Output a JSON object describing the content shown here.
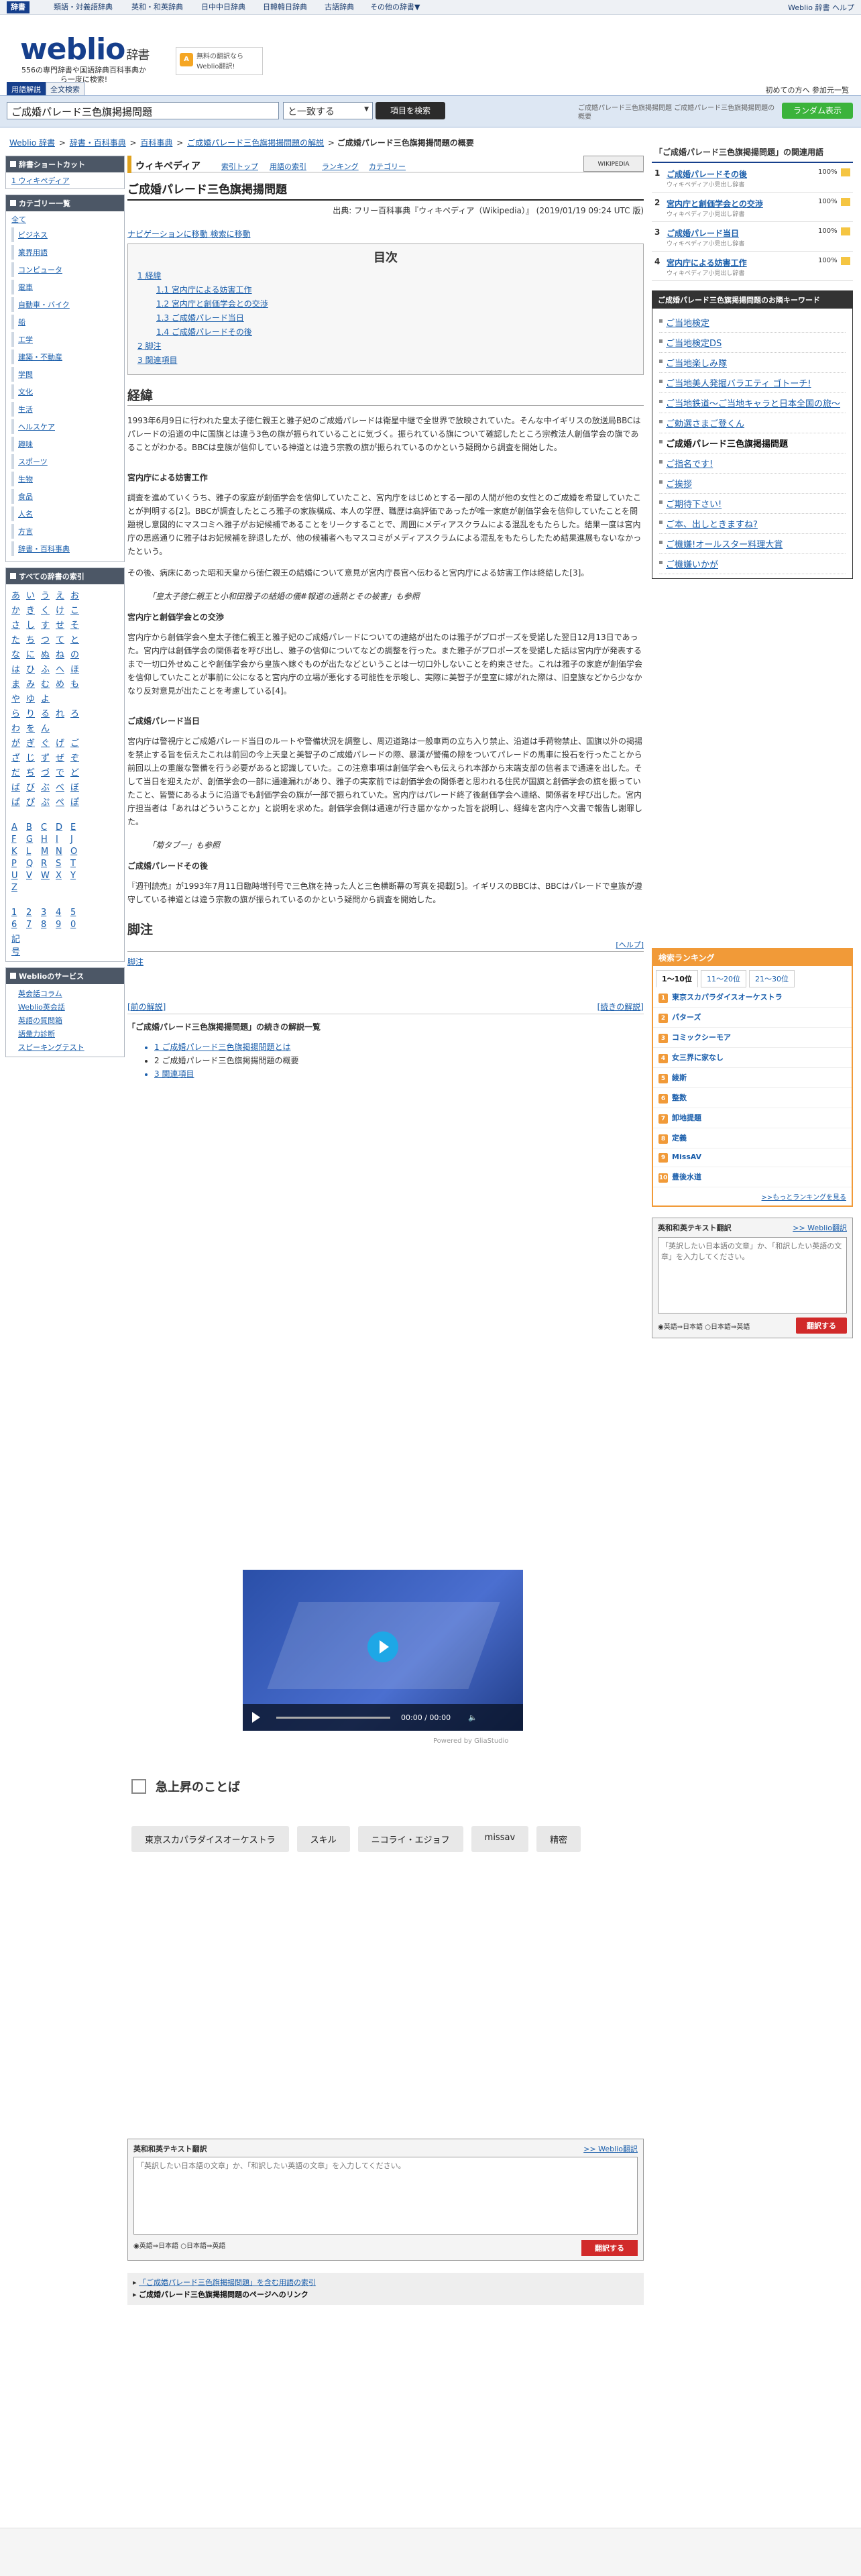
{
  "topbar": {
    "tabs": [
      "辞書",
      "類語・対義語辞典",
      "英和・和英辞典",
      "日中中日辞典",
      "日韓韓日辞典",
      "古語辞典",
      "その他の辞書▼"
    ],
    "right": "Weblio 辞書 ヘルプ"
  },
  "header": {
    "logo": "weblio",
    "logo_suffix": "辞書",
    "sub": "556の専門辞書や国語辞典百科事典から一度に検索!",
    "ad": "無料の翻訳ならWeblio翻訳!",
    "links": "初めての方へ  参加元一覧",
    "mode_on": "用語解説",
    "mode_off": "全文検索"
  },
  "search": {
    "value": "ご成婚パレード三色旗掲揚問題",
    "mode": "と一致する",
    "button": "項目を検索",
    "suggest": "ご成婚パレード三色旗掲揚問題 ご成婚パレード三色旗掲揚問題の概要",
    "random": "ランダム表示"
  },
  "breadcrumb": [
    "Weblio 辞書",
    "辞書・百科事典",
    "百科事典",
    "ご成婚パレード三色旗掲揚問題の解説",
    "ご成婚パレード三色旗掲揚問題の概要"
  ],
  "left": {
    "shortcut_hd": "辞書ショートカット",
    "shortcut": "1 ウィキペディア",
    "cat_hd": "カテゴリー一覧",
    "cat_all": "全て",
    "cats": [
      "ビジネス",
      "業界用語",
      "コンピュータ",
      "電車",
      "自動車・バイク",
      "船",
      "工学",
      "建築・不動産",
      "学問",
      "文化",
      "生活",
      "ヘルスケア",
      "趣味",
      "スポーツ",
      "生物",
      "食品",
      "人名",
      "方言",
      "辞書・百科事典"
    ],
    "kana": [
      "あ",
      "い",
      "う",
      "え",
      "お",
      "か",
      "き",
      "く",
      "け",
      "こ",
      "さ",
      "し",
      "す",
      "せ",
      "そ",
      "た",
      "ち",
      "つ",
      "て",
      "と",
      "な",
      "に",
      "ぬ",
      "ね",
      "の",
      "は",
      "ひ",
      "ふ",
      "へ",
      "ほ",
      "ま",
      "み",
      "む",
      "め",
      "も",
      "や",
      "ゆ",
      "よ",
      "",
      "",
      "ら",
      "り",
      "る",
      "れ",
      "ろ",
      "わ",
      "を",
      "ん",
      "",
      "",
      "が",
      "ぎ",
      "ぐ",
      "げ",
      "ご",
      "ざ",
      "じ",
      "ず",
      "ぜ",
      "ぞ",
      "だ",
      "ぢ",
      "づ",
      "で",
      "ど",
      "ば",
      "び",
      "ぶ",
      "べ",
      "ぼ",
      "ぱ",
      "ぴ",
      "ぷ",
      "ぺ",
      "ぽ"
    ],
    "alpha": [
      "A",
      "B",
      "C",
      "D",
      "E",
      "F",
      "G",
      "H",
      "I",
      "J",
      "K",
      "L",
      "M",
      "N",
      "O",
      "P",
      "Q",
      "R",
      "S",
      "T",
      "U",
      "V",
      "W",
      "X",
      "Y",
      "Z"
    ],
    "nums": [
      "1",
      "2",
      "3",
      "4",
      "5",
      "6",
      "7",
      "8",
      "9",
      "0",
      "記号"
    ],
    "srv_hd": "Weblioのサービス",
    "srvs": [
      "英会話コラム",
      "Weblio英会話",
      "英語の質問箱",
      "語彙力診断",
      "スピーキングテスト"
    ]
  },
  "wp": {
    "name": "ウィキペディア",
    "links": [
      "索引トップ",
      "用語の索引",
      "ランキング",
      "カテゴリー"
    ],
    "logo": "WIKIPEDIA"
  },
  "article": {
    "title": "ご成婚パレード三色旗掲揚問題",
    "source": "出典: フリー百科事典『ウィキペディア（Wikipedia）』 (2019/01/19 09:24 UTC 版)",
    "nav": "ナビゲーションに移動 検索に移動",
    "toc_title": "目次",
    "toc": [
      "1 経緯",
      "1.1 宮内庁による妨害工作",
      "1.2 宮内庁と創価学会との交渉",
      "1.3 ご成婚パレード当日",
      "1.4 ご成婚パレードその後",
      "2 脚注",
      "3 関連項目"
    ],
    "h_keii": "経緯",
    "p1": "1993年6月9日に行われた皇太子徳仁親王と雅子妃のご成婚パレードは衛星中継で全世界で放映されていた。そんな中イギリスの放送局BBCはパレードの沿道の中に国旗とは違う3色の旗が振られていることに気づく。振られている旗について確認したところ宗教法人創価学会の旗であることがわかる。BBCは皇族が信仰している神道とは違う宗教の旗が振られているのかという疑問から調査を開始した。",
    "h1": "宮内庁による妨害工作",
    "p2": "調査を進めていくうち、雅子の家庭が創価学会を信仰していたこと、宮内庁をはじめとする一部の人間が他の女性とのご成婚を希望していたことが判明する[2]。BBCが調査したところ雅子の家族構成、本人の学歴、職歴は高評価であったが唯一家庭が創価学会を信仰していたことを問題視し意図的にマスコミへ雅子がお妃候補であることをリークすることで、周囲にメディアスクラムによる混乱をもたらした。結果一度は宮内庁の思惑通りに雅子はお妃候補を辞退したが、他の候補者へもマスコミがメディアスクラムによる混乱をもたらしたため結果進展もないなかったという。",
    "p3": "その後、病床にあった昭和天皇から徳仁親王の結婚について意見が宮内庁長官へ伝わると宮内庁による妨害工作は終結した[3]。",
    "q1": "「皇太子徳仁親王と小和田雅子の結婚の儀#報道の過熱とその被害」も参照",
    "h2": "宮内庁と創価学会との交渉",
    "p4": "宮内庁から創価学会へ皇太子徳仁親王と雅子妃のご成婚パレードについての連絡が出たのは雅子がプロポーズを受諾した翌日12月13日であった。宮内庁は創価学会の関係者を呼び出し、雅子の信仰についてなどの調整を行った。また雅子がプロポーズを受諾した話は宮内庁が発表するまで一切口外せぬことや創価学会から皇族へ嫁ぐものが出たなどということは一切口外しないことを約束させた。これは雅子の家庭が創価学会を信仰していたことが事前に公になると宮内庁の立場が悪化する可能性を示唆し、実際に美智子が皇室に嫁がれた際は、旧皇族などから少なかなり反対意見が出たことを考慮している[4]。",
    "h3": "ご成婚パレード当日",
    "p5": "宮内庁は警視庁とご成婚パレード当日のルートや警備状況を調整し、周辺道路は一般車両の立ち入り禁止、沿道は手荷物禁止、国旗以外の掲揚を禁止する旨を伝えたこれは前回の今上天皇と美智子のご成婚パレードの際、暴漢が警備の隙をついてパレードの馬車に投石を行ったことから前回以上の重厳な警備を行う必要があると認識していた。この注意事項は創価学会へも伝えられ本部から末端支部の信者まで通達を出した。そして当日を迎えたが、創価学会の一部に通達漏れがあり、雅子の実家前では創価学会の関係者と思われる住民が国旗と創価学会の旗を振っていたこと、皆警にあるように沿道でも創価学会の旗が一部で振られていた。宮内庁はパレード終了後創価学会へ連絡、関係者を呼び出した。宮内庁担当者は「あれはどういうことか」と説明を求めた。創価学会側は通達が行き届かなかった旨を説明し、経緯を宮内庁へ文書で報告し謝罪した。",
    "q2": "「菊タブー」も参照",
    "h4": "ご成婚パレードその後",
    "p6": "『週刊読売』が1993年7月11日臨時増刊号で三色旗を持った人と三色横断幕の写真を掲載[5]。イギリスのBBCは、BBCはパレードで皇族が遵守している神道とは違う宗教の旗が振られているのかという疑問から調査を開始した。",
    "h_fn": "脚注",
    "help": "[ヘルプ]",
    "fn_link": "脚注",
    "prev": "[前の解説]",
    "next": "[続きの解説]",
    "cont_hd": "「ご成婚パレード三色旗掲揚問題」の続きの解説一覧",
    "cont": [
      "1 ご成婚パレード三色旗掲揚問題とは",
      "2 ご成婚パレード三色旗掲揚問題の概要",
      "3 関連項目"
    ]
  },
  "right": {
    "rel_hd": "「ご成婚パレード三色旗掲揚問題」の関連用語",
    "rel": [
      {
        "n": "1",
        "t": "ご成婚パレードその後",
        "src": "ウィキペディア小見出し辞書",
        "p": "100%"
      },
      {
        "n": "2",
        "t": "宮内庁と創価学会との交渉",
        "src": "ウィキペディア小見出し辞書",
        "p": "100%"
      },
      {
        "n": "3",
        "t": "ご成婚パレード当日",
        "src": "ウィキペディア小見出し辞書",
        "p": "100%"
      },
      {
        "n": "4",
        "t": "宮内庁による妨害工作",
        "src": "ウィキペディア小見出し辞書",
        "p": "100%"
      }
    ],
    "kw_hd": "ご成婚パレード三色旗掲揚問題のお隣キーワード",
    "kw": [
      "ご当地検定",
      "ご当地検定DS",
      "ご当地楽しみ隊",
      "ご当地美人発掘バラエティ ゴトーチ!",
      "ご当地鉄道〜ご当地キャラと日本全国の旅〜",
      "ご勅選さまご登くん",
      "ご成婚パレード三色旗掲揚問題",
      "ご指名です!",
      "ご挨拶",
      "ご期待下さい!",
      "ご本、出しときますね?",
      "ご機嫌!オールスター料理大賞",
      "ご機嫌いかが"
    ],
    "kw_cur": 6,
    "rank_hd": "検索ランキング",
    "rank_tabs": [
      "1〜10位",
      "11〜20位",
      "21〜30位"
    ],
    "rank": [
      "東京スカパラダイスオーケストラ",
      "パターズ",
      "コミックシーモア",
      "女三界に家なし",
      "綾斯",
      "整数",
      "卸地提題",
      "定義",
      "MissAV",
      "豊後水道"
    ],
    "rank_more": ">>もっとランキングを見る",
    "tr_hd": "英和和英テキスト翻訳",
    "tr_link": ">> Weblio翻訳",
    "tr_ph": "「英訳したい日本語の文章」か、「和訳したい英語の文章」を入力してください。",
    "tr_opt": "◉英語⇒日本語 ○日本語⇒英語",
    "tr_btn": "翻訳する"
  },
  "video": {
    "time": "00:00 / 00:00",
    "powered": "Powered by GliaStudio"
  },
  "rising": {
    "title": "急上昇のことば",
    "chips": [
      "東京スカパラダイスオーケストラ",
      "スキル",
      "ニコライ・エジョフ",
      "missav",
      "精密"
    ]
  },
  "bottom": {
    "tr_hd": "英和和英テキスト翻訳",
    "tr_link": ">> Weblio翻訳",
    "tr_ph": "「英訳したい日本語の文章」か、「和訳したい英語の文章」を入力してください。",
    "tr_opt": "◉英語⇒日本語 ○日本語⇒英語",
    "tr_btn": "翻訳する",
    "link1": "「ご成婚パレード三色旗掲揚問題」を含む用語の索引",
    "link2": "ご成婚パレード三色旗掲揚問題のページへのリンク"
  }
}
